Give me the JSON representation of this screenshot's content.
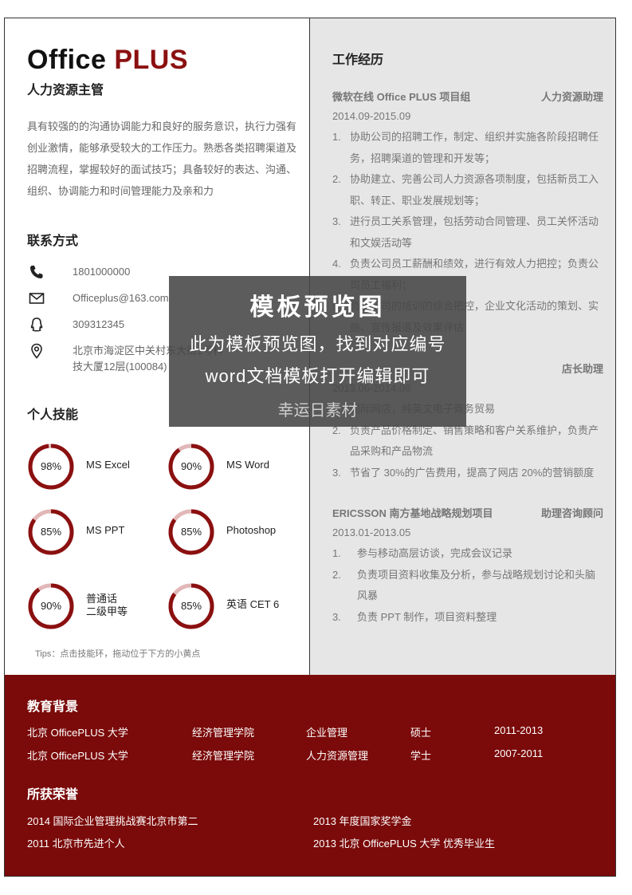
{
  "header": {
    "brand_part1": "Office",
    "brand_part2": "PLUS",
    "role": "人力资源主管",
    "summary": "具有较强的的沟通协调能力和良好的服务意识，执行力强有创业激情，能够承受较大的工作压力。熟悉各类招聘渠道及招聘流程，掌握较好的面试技巧；具备较好的表达、沟通、组织、协调能力和时间管理能力及亲和力"
  },
  "contact": {
    "title": "联系方式",
    "items": [
      {
        "icon": "phone-icon",
        "text": "1801000000"
      },
      {
        "icon": "mail-icon",
        "text": "Officeplus@163.com"
      },
      {
        "icon": "qq-icon",
        "text": "309312345"
      },
      {
        "icon": "location-icon",
        "text": "北京市海淀区中关村东大街1号科技大厦12层(100084)"
      }
    ]
  },
  "skills": {
    "title": "个人技能",
    "items": [
      {
        "pct_label": "98%",
        "value": 0.98,
        "name": "MS Excel"
      },
      {
        "pct_label": "90%",
        "value": 0.9,
        "name": "MS Word"
      },
      {
        "pct_label": "85%",
        "value": 0.85,
        "name": "MS PPT"
      },
      {
        "pct_label": "85%",
        "value": 0.85,
        "name": "Photoshop"
      },
      {
        "pct_label": "90%",
        "value": 0.9,
        "name": "普通话\n二级甲等"
      },
      {
        "pct_label": "85%",
        "value": 0.85,
        "name": "英语  CET 6"
      }
    ],
    "tips": "Tips：点击技能环，拖动位于下方的小黄点"
  },
  "experience": {
    "title": "工作经历",
    "jobs": [
      {
        "org": "微软在线  Office  PLUS 项目组",
        "position": "人力资源助理",
        "date": "2014.09-2015.09",
        "duties": [
          "协助公司的招聘工作，制定、组织并实施各阶段招聘任务，招聘渠道的管理和开发等；",
          "协助建立、完善公司人力资源各项制度，包括新员工入职、转正、职业发展规划等；",
          "进行员工关系管理，包括劳动合同管理、员工关怀活动和文娱活动等",
          "负责公司员工薪酬和绩效，进行有效人力把控；负责公司员工福利；",
          "负责公司的培训的综合把控，企业文化活动的策划、实施、宣传报道及效果评估"
        ]
      },
      {
        "org": "",
        "position": "店长助理",
        "date": "2013.06-2014.06",
        "duties": [
          "国际网店，纯英文电子商务贸易",
          "负责产品价格制定、销售策略和客户关系维护，负责产品采购和产品物流",
          "节省了 30%的广告费用，提高了网店 20%的营销额度"
        ]
      },
      {
        "org": "ERICSSON 南方基地战略规划项目",
        "position": "助理咨询顾问",
        "date": "2013.01-2013.05",
        "duties": [
          "参与移动高层访谈，完成会议记录",
          "负责项目资料收集及分析，参与战略规划讨论和头脑风暴",
          "负责 PPT 制作，项目资料整理"
        ]
      }
    ]
  },
  "education": {
    "title": "教育背景",
    "rows": [
      {
        "school": "北京 OfficePLUS 大学",
        "college": "经济管理学院",
        "major": "企业管理",
        "degree": "硕士",
        "period": "2011-2013"
      },
      {
        "school": "北京 OfficePLUS 大学",
        "college": "经济管理学院",
        "major": "人力资源管理",
        "degree": "学士",
        "period": "2007-2011"
      }
    ]
  },
  "honors": {
    "title": "所获荣誉",
    "items": [
      "2014  国际企业管理挑战赛北京市第二",
      "2013 年度国家奖学金",
      "2011  北京市先进个人",
      "2013  北京 OfficePLUS 大学  优秀毕业生"
    ]
  },
  "watermark": {
    "line1": "模板预览图",
    "line2": "此为模板预览图，找到对应编号",
    "line3": "word文档模板打开编辑即可",
    "line4": "幸运日素材"
  },
  "colors": {
    "accent": "#8b1010",
    "ring_track": "#e2b7b7",
    "footer_bg": "#7b0a0a",
    "right_bg": "#e6e6e6"
  }
}
